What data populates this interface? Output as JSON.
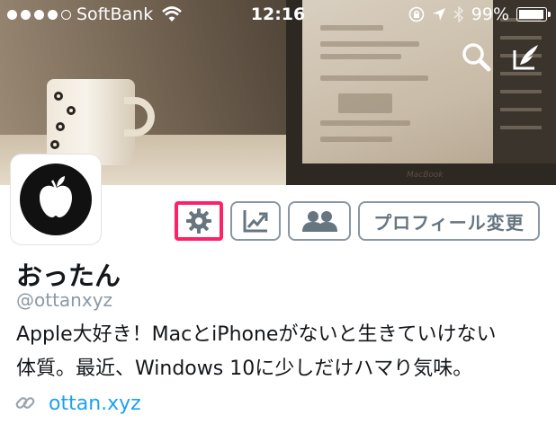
{
  "status_bar": {
    "carrier": "SoftBank",
    "time": "12:16",
    "battery": "99%"
  },
  "header": {
    "laptop_brand": "MacBook"
  },
  "actions": {
    "edit_profile_label": "プロフィール変更"
  },
  "profile": {
    "name": "おったん",
    "handle": "@ottanxyz",
    "bio_line1": "Apple大好き！MacとiPhoneがないと生きていけない",
    "bio_line2": "体質。最近、Windows 10に少しだけハマり気味。",
    "url": "ottan.xyz"
  },
  "icons": {
    "search": "search-icon",
    "compose": "compose-icon",
    "settings": "gear-icon",
    "analytics": "chart-up-icon",
    "people": "people-icon",
    "link": "link-icon"
  },
  "colors": {
    "highlight": "#ff2166",
    "link": "#1da1f2",
    "button_border": "#8a96a3",
    "icon_gray": "#66757f"
  }
}
